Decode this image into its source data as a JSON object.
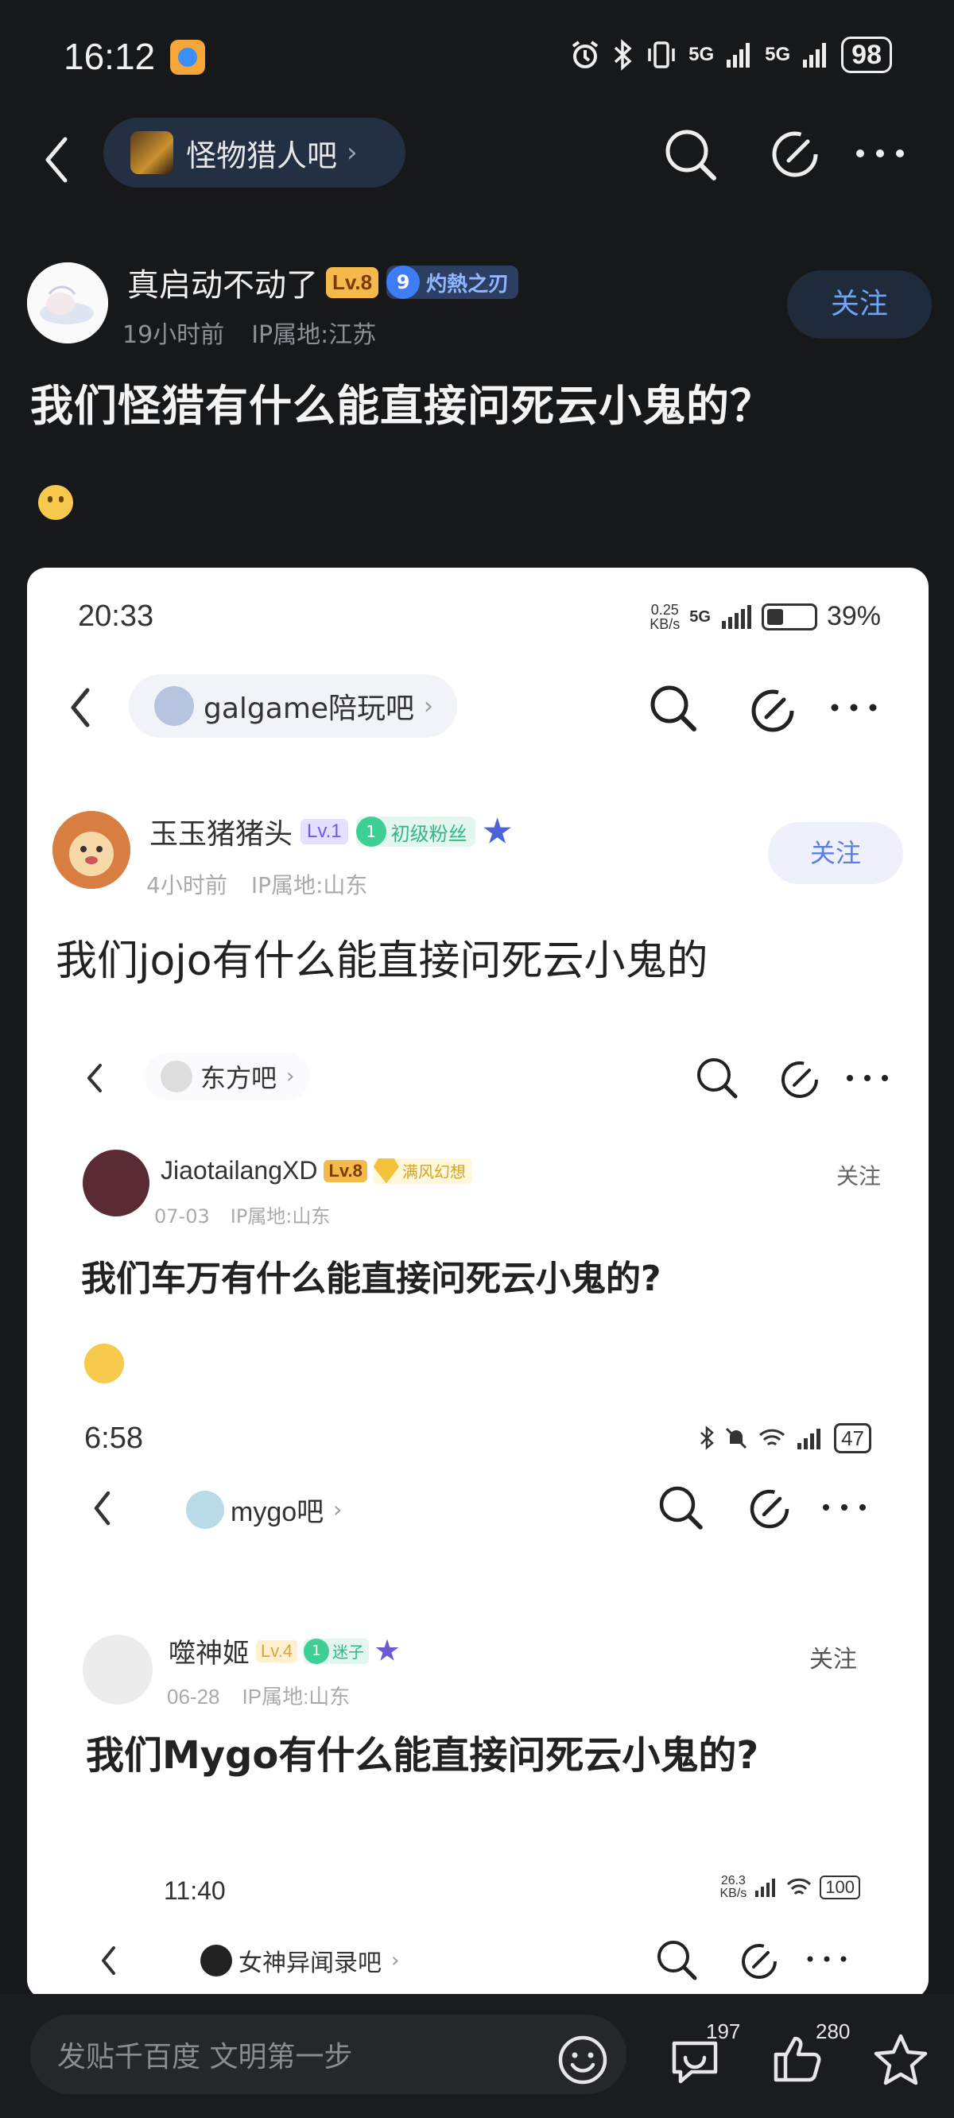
{
  "status_bar": {
    "time": "16:12",
    "signal1": "5G",
    "signal2": "5G",
    "battery": "98"
  },
  "nav": {
    "forum_name": "怪物猎人吧"
  },
  "post": {
    "author": "真启动不动了",
    "level": "Lv.8",
    "title_badge_num": "9",
    "title_badge": "灼熱之刃",
    "time_ago": "19小时前",
    "ip": "IP属地:江苏",
    "follow_label": "关注",
    "title": "我们怪猎有什么能直接问死云小鬼的？"
  },
  "embed": {
    "time": "20:33",
    "net_speed": "0.25\nKB/s",
    "signal": "5G",
    "battery": "39%",
    "forum_name": "galgame陪玩吧",
    "author": "玉玉猪猪头",
    "level": "Lv.1",
    "fan_num": "1",
    "fan_label": "初级粉丝",
    "time_ago": "4小时前",
    "ip": "IP属地:山东",
    "follow_label": "关注",
    "title": "我们jojo有什么能直接问死云小鬼的"
  },
  "embed2": {
    "forum_name": "东方吧",
    "author": "JiaotailangXD",
    "level": "Lv.8",
    "tag": "满风幻想",
    "date": "07-03",
    "ip": "IP属地:山东",
    "follow_label": "关注",
    "title": "我们车万有什么能直接问死云小鬼的?"
  },
  "embed3": {
    "time": "6:58",
    "battery": "47",
    "forum_name": "mygo吧",
    "author": "噬神姬",
    "level": "Lv.4",
    "fan_num": "1",
    "fan_label": "迷子",
    "date": "06-28",
    "ip": "IP属地:山东",
    "follow_label": "关注",
    "title": "我们Mygo有什么能直接问死云小鬼的?"
  },
  "embed4": {
    "time": "11:40",
    "net_speed": "26.3\nKB/s",
    "battery": "100",
    "forum_name": "女神异闻录吧"
  },
  "bottom": {
    "comment_placeholder": "发贴千百度 文明第一步",
    "comment_count": "197",
    "like_count": "280"
  }
}
